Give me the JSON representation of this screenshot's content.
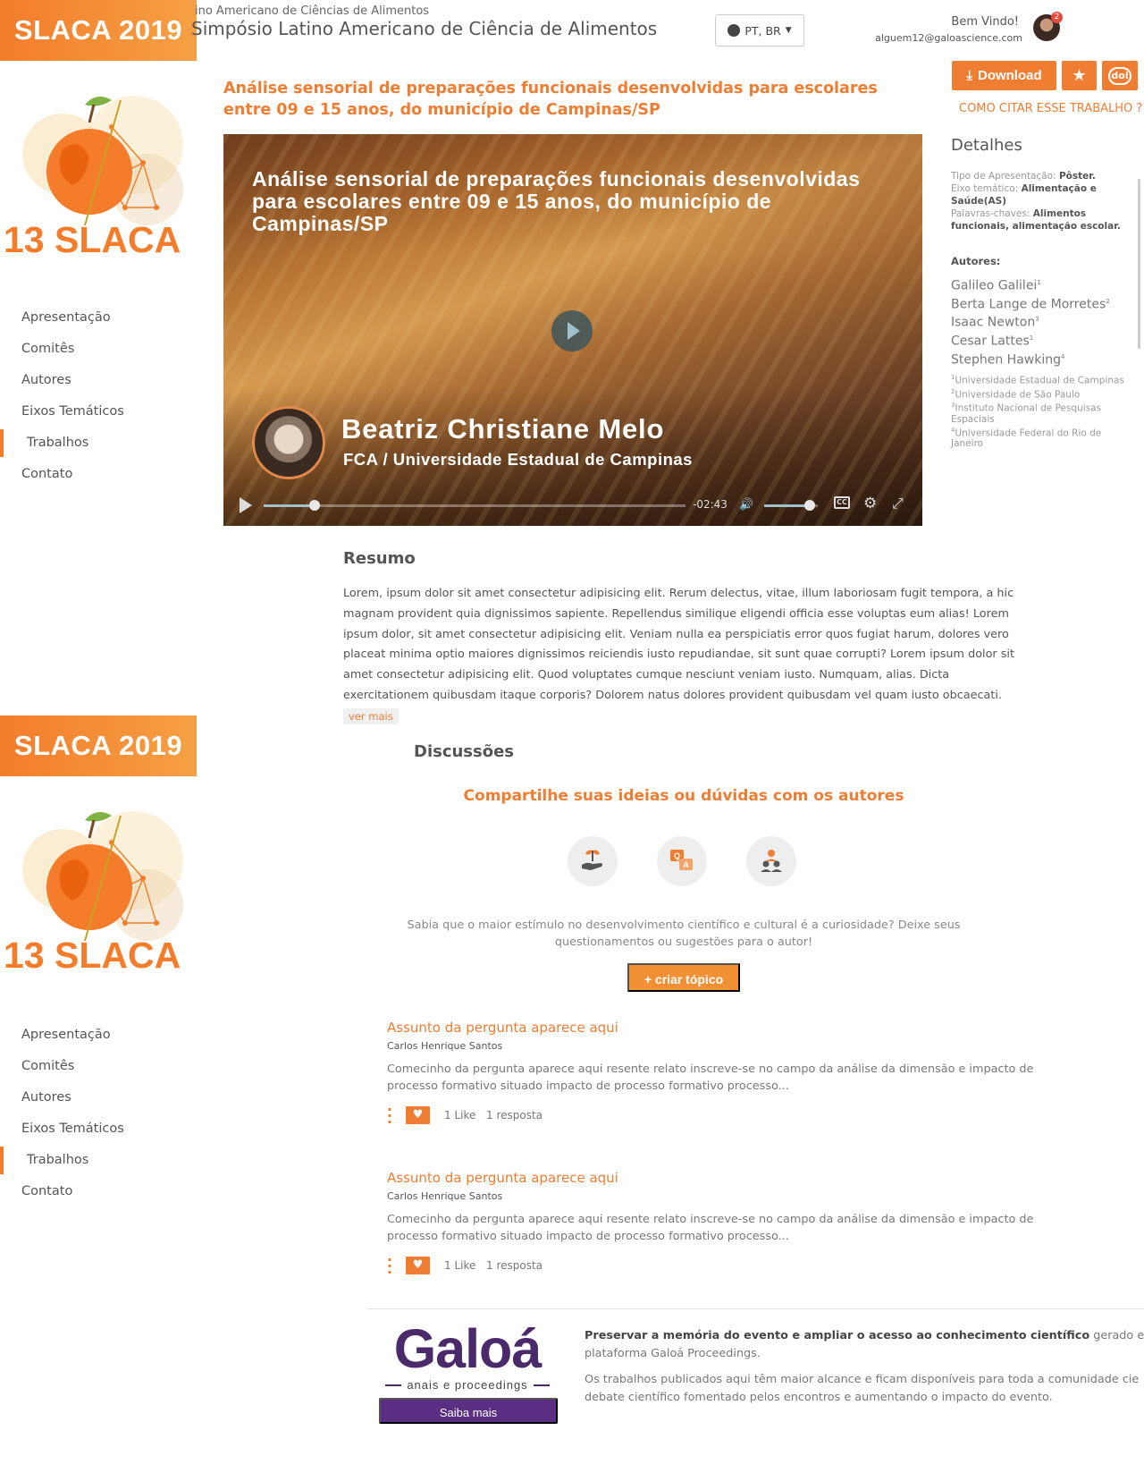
{
  "sidebar": {
    "badge": "SLACA 2019",
    "logo_text": "13 SLACA",
    "nav": [
      "Apresentação",
      "Comitês",
      "Autores",
      "Eixos Temáticos",
      "Trabalhos",
      "Contato"
    ],
    "active_item": "Trabalhos"
  },
  "header": {
    "subtitle": "ino Americano de Ciências de Alimentos",
    "title": "Simpósio Latino Americano de Ciência de Alimentos",
    "language": "PT, BR",
    "welcome": "Bem Vindo!",
    "email": "alguem12@galoascience.com",
    "notification_count": "2"
  },
  "actions": {
    "download_label": "Download",
    "doi_label": "doi",
    "cite_link": "COMO CITAR ESSE TRABALHO ?"
  },
  "paper": {
    "title": "Análise sensorial de preparações funcionais desenvolvidas para escolares entre 09 e 15 anos, do município de Campinas/SP"
  },
  "video": {
    "title": "Análise sensorial de preparações funcionais desenvolvidas para escolares entre 09 e 15 anos, do município de Campinas/SP",
    "speaker_name": "Beatriz Christiane Melo",
    "speaker_affiliation": "FCA / Universidade Estadual de Campinas",
    "time_remaining": "-02:43",
    "progress": 0.12,
    "volume": 0.85,
    "cc_label": "CC"
  },
  "details": {
    "title": "Detalhes",
    "tipo_label": "Tipo de Apresentação: ",
    "tipo_value": "Pôster.",
    "eixo_label": "Eixo temático: ",
    "eixo_value": "Alimentação e Saúde(AS)",
    "palavras_label": "Palavras-chaves: ",
    "palavras_value": "Alimentos funcionais, alimentação escolar.",
    "authors_label": "Autores:",
    "authors": [
      {
        "name": "Galileo Galilei",
        "ref": "1"
      },
      {
        "name": "Berta Lange de Morretes",
        "ref": "2"
      },
      {
        "name": "Isaac Newton",
        "ref": "3"
      },
      {
        "name": "Cesar Lattes",
        "ref": "1"
      },
      {
        "name": "Stephen Hawking",
        "ref": "4"
      }
    ],
    "institutions": [
      {
        "ref": "1",
        "name": "Universidade Estadual de Campinas"
      },
      {
        "ref": "2",
        "name": "Universidade de São Paulo"
      },
      {
        "ref": "3",
        "name": "Instituto Nacional de Pesquisas Espaciais"
      },
      {
        "ref": "4",
        "name": "Universidade Federal do Rio de Janeiro"
      }
    ]
  },
  "resumo": {
    "title": "Resumo",
    "text": "Lorem, ipsum dolor sit amet consectetur adipisicing elit. Rerum delectus, vitae, illum laboriosam fugit tempora, a hic magnam provident quia dignissimos sapiente. Repellendus similique eligendi officia esse voluptas eum alias! Lorem ipsum dolor, sit amet consectetur adipisicing elit. Veniam nulla ea perspiciatis error quos fugiat harum, dolores vero placeat minima optio maiores dignissimos reiciendis iusto repudiandae, sit sunt quae corrupti? Lorem ipsum dolor sit amet consectetur adipisicing elit. Quod voluptates cumque nesciunt veniam iusto. Numquam, alias. Dicta exercitationem quibusdam itaque corporis? Dolorem natus dolores provident quibusdam vel quam iusto obcaecati.",
    "ver_mais": "ver mais"
  },
  "discussoes": {
    "title": "Discussões",
    "subtitle": "Compartilhe suas ideias ou dúvidas com os autores",
    "description": "Sabia que o maior estímulo no desenvolvimento científico e cultural é a curiosidade? Deixe seus questionamentos ou sugestões para o autor!",
    "create_button": "+ criar tópico",
    "icons": [
      "hand-plant-icon",
      "question-answer-icon",
      "people-icon"
    ],
    "topics": [
      {
        "title": "Assunto da pergunta aparece aqui",
        "author": "Carlos Henrique Santos",
        "excerpt": "Comecinho da pergunta aparece aqui resente relato inscreve-se no campo da análise da dimensão e impacto de processo formativo situado impacto de processo formativo processo...",
        "likes": "1 Like",
        "replies": "1 resposta"
      },
      {
        "title": "Assunto da pergunta aparece aqui",
        "author": "Carlos Henrique Santos",
        "excerpt": "Comecinho da pergunta aparece aqui resente relato inscreve-se no campo da análise da dimensão e impacto de processo formativo situado impacto de processo formativo processo...",
        "likes": "1 Like",
        "replies": "1 resposta"
      }
    ]
  },
  "footer": {
    "logo_word": "Galoá",
    "logo_sub": "anais e proceedings",
    "button": "Saiba mais",
    "p1_bold": "Preservar a memória do evento e ampliar o acesso ao conhecimento científico",
    "p1_rest": " gerado em eve",
    "p1_line2": "plataforma Galoá Proceedings.",
    "p2_line1": "Os trabalhos publicados aqui têm maior alcance e ficam disponíveis para toda a comunidade cie",
    "p2_line2": "debate científico fomentado pelos encontros e aumentando o impacto do evento."
  },
  "colors": {
    "accent": "#ef7d32",
    "brand_purple": "#5a2f83"
  }
}
